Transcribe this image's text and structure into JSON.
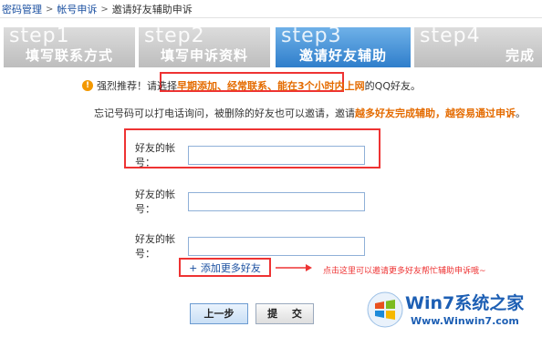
{
  "breadcrumb": {
    "items": [
      "密码管理",
      "帐号申诉",
      "邀请好友辅助申诉"
    ],
    "separator": ">"
  },
  "steps": [
    {
      "num": "step1",
      "label": "填写联系方式",
      "state": "inactive"
    },
    {
      "num": "step2",
      "label": "填写申诉资料",
      "state": "inactive"
    },
    {
      "num": "step3",
      "label": "邀请好友辅助",
      "state": "active"
    },
    {
      "num": "step4",
      "label": "完成",
      "state": "inactive"
    }
  ],
  "tip": {
    "prefix": "强烈推荐！请选择",
    "highlight": "早期添加、经常联系、能在3个小时内上网",
    "suffix": "的QQ好友。"
  },
  "tip2": {
    "prefix": "忘记号码可以打电话询问，被删除的好友也可以邀请，邀请",
    "highlight": "越多好友完成辅助，越容易通过申诉",
    "suffix": "。"
  },
  "fields": [
    {
      "label": "好友的帐号：",
      "value": ""
    },
    {
      "label": "好友的帐号：",
      "value": ""
    },
    {
      "label": "好友的帐号：",
      "value": ""
    }
  ],
  "add_more": "+ 添加更多好友",
  "hint": "点击这里可以邀请更多好友帮忙辅助申诉哦~",
  "buttons": {
    "prev": "上一步",
    "submit": "提 交"
  },
  "watermark": {
    "title": "Win7系统之家",
    "url": "Www.Winwin7.com"
  },
  "colors": {
    "accent": "#2f7ecb",
    "warning": "#e33",
    "orange": "#e46b00"
  }
}
